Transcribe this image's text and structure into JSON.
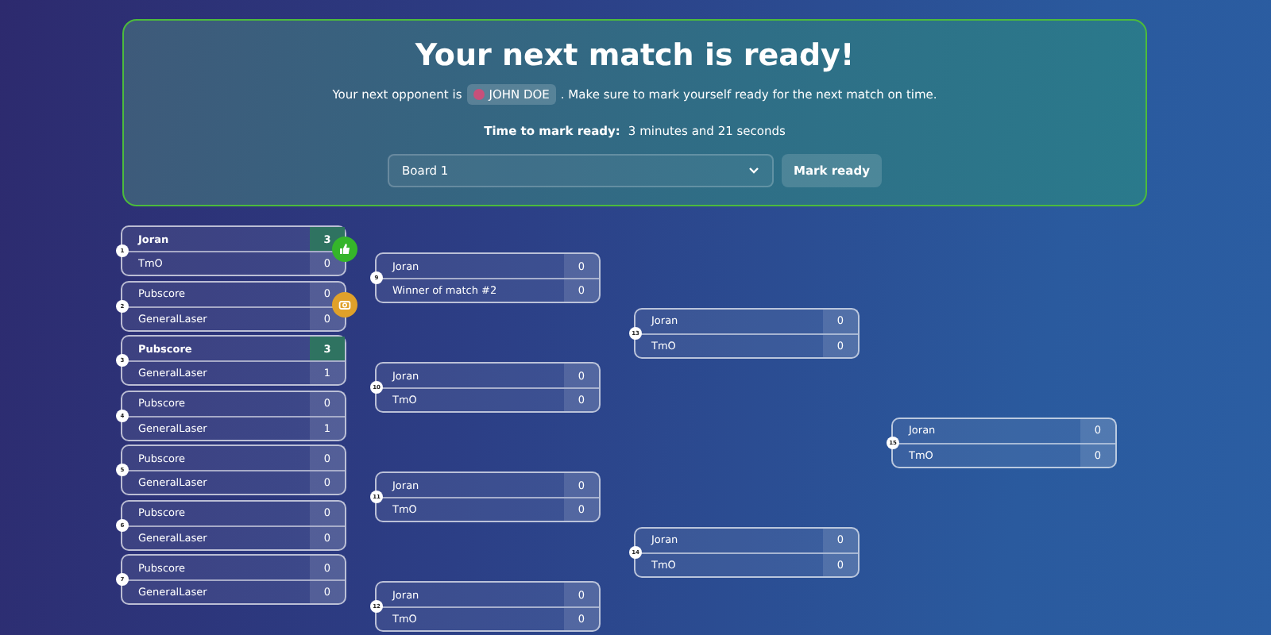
{
  "banner": {
    "title": "Your next match is ready!",
    "message_before": "Your next opponent is",
    "opponent": "JOHN DOE",
    "message_after": ". Make sure to mark yourself ready for the next match on time.",
    "time_label": "Time to mark ready:",
    "time_value": "3 minutes and 21 seconds",
    "board_select": {
      "value": "Board 1"
    },
    "button": "Mark ready"
  },
  "rounds": [
    {
      "matches": [
        {
          "number": "1",
          "indicator": {
            "kind": "thumbs-up"
          },
          "players": [
            {
              "name": "Joran",
              "score": "3",
              "winner": true
            },
            {
              "name": "TmO",
              "score": "0",
              "winner": false
            }
          ]
        },
        {
          "number": "2",
          "indicator": {
            "kind": "camera"
          },
          "players": [
            {
              "name": "Pubscore",
              "score": "0",
              "winner": false
            },
            {
              "name": "GeneralLaser",
              "score": "0",
              "winner": false
            }
          ]
        },
        {
          "number": "3",
          "players": [
            {
              "name": "Pubscore",
              "score": "3",
              "winner": true
            },
            {
              "name": "GeneralLaser",
              "score": "1",
              "winner": false
            }
          ]
        },
        {
          "number": "4",
          "players": [
            {
              "name": "Pubscore",
              "score": "0",
              "winner": false
            },
            {
              "name": "GeneralLaser",
              "score": "1",
              "winner": false
            }
          ]
        },
        {
          "number": "5",
          "players": [
            {
              "name": "Pubscore",
              "score": "0",
              "winner": false
            },
            {
              "name": "GeneralLaser",
              "score": "0",
              "winner": false
            }
          ]
        },
        {
          "number": "6",
          "players": [
            {
              "name": "Pubscore",
              "score": "0",
              "winner": false
            },
            {
              "name": "GeneralLaser",
              "score": "0",
              "winner": false
            }
          ]
        },
        {
          "number": "7",
          "players": [
            {
              "name": "Pubscore",
              "score": "0",
              "winner": false
            },
            {
              "name": "GeneralLaser",
              "score": "0",
              "winner": false
            }
          ]
        }
      ]
    },
    {
      "matches": [
        {
          "number": "9",
          "players": [
            {
              "name": "Joran",
              "score": "0",
              "winner": false
            },
            {
              "name": "Winner of match #2",
              "score": "0",
              "winner": false
            }
          ]
        },
        {
          "number": "10",
          "players": [
            {
              "name": "Joran",
              "score": "0",
              "winner": false
            },
            {
              "name": "TmO",
              "score": "0",
              "winner": false
            }
          ]
        },
        {
          "number": "11",
          "players": [
            {
              "name": "Joran",
              "score": "0",
              "winner": false
            },
            {
              "name": "TmO",
              "score": "0",
              "winner": false
            }
          ]
        },
        {
          "number": "12",
          "players": [
            {
              "name": "Joran",
              "score": "0",
              "winner": false
            },
            {
              "name": "TmO",
              "score": "0",
              "winner": false
            }
          ]
        }
      ]
    },
    {
      "matches": [
        {
          "number": "13",
          "players": [
            {
              "name": "Joran",
              "score": "0",
              "winner": false
            },
            {
              "name": "TmO",
              "score": "0",
              "winner": false
            }
          ]
        },
        {
          "number": "14",
          "players": [
            {
              "name": "Joran",
              "score": "0",
              "winner": false
            },
            {
              "name": "TmO",
              "score": "0",
              "winner": false
            }
          ]
        }
      ]
    },
    {
      "matches": [
        {
          "number": "15",
          "players": [
            {
              "name": "Joran",
              "score": "0",
              "winner": false
            },
            {
              "name": "TmO",
              "score": "0",
              "winner": false
            }
          ]
        }
      ]
    }
  ]
}
